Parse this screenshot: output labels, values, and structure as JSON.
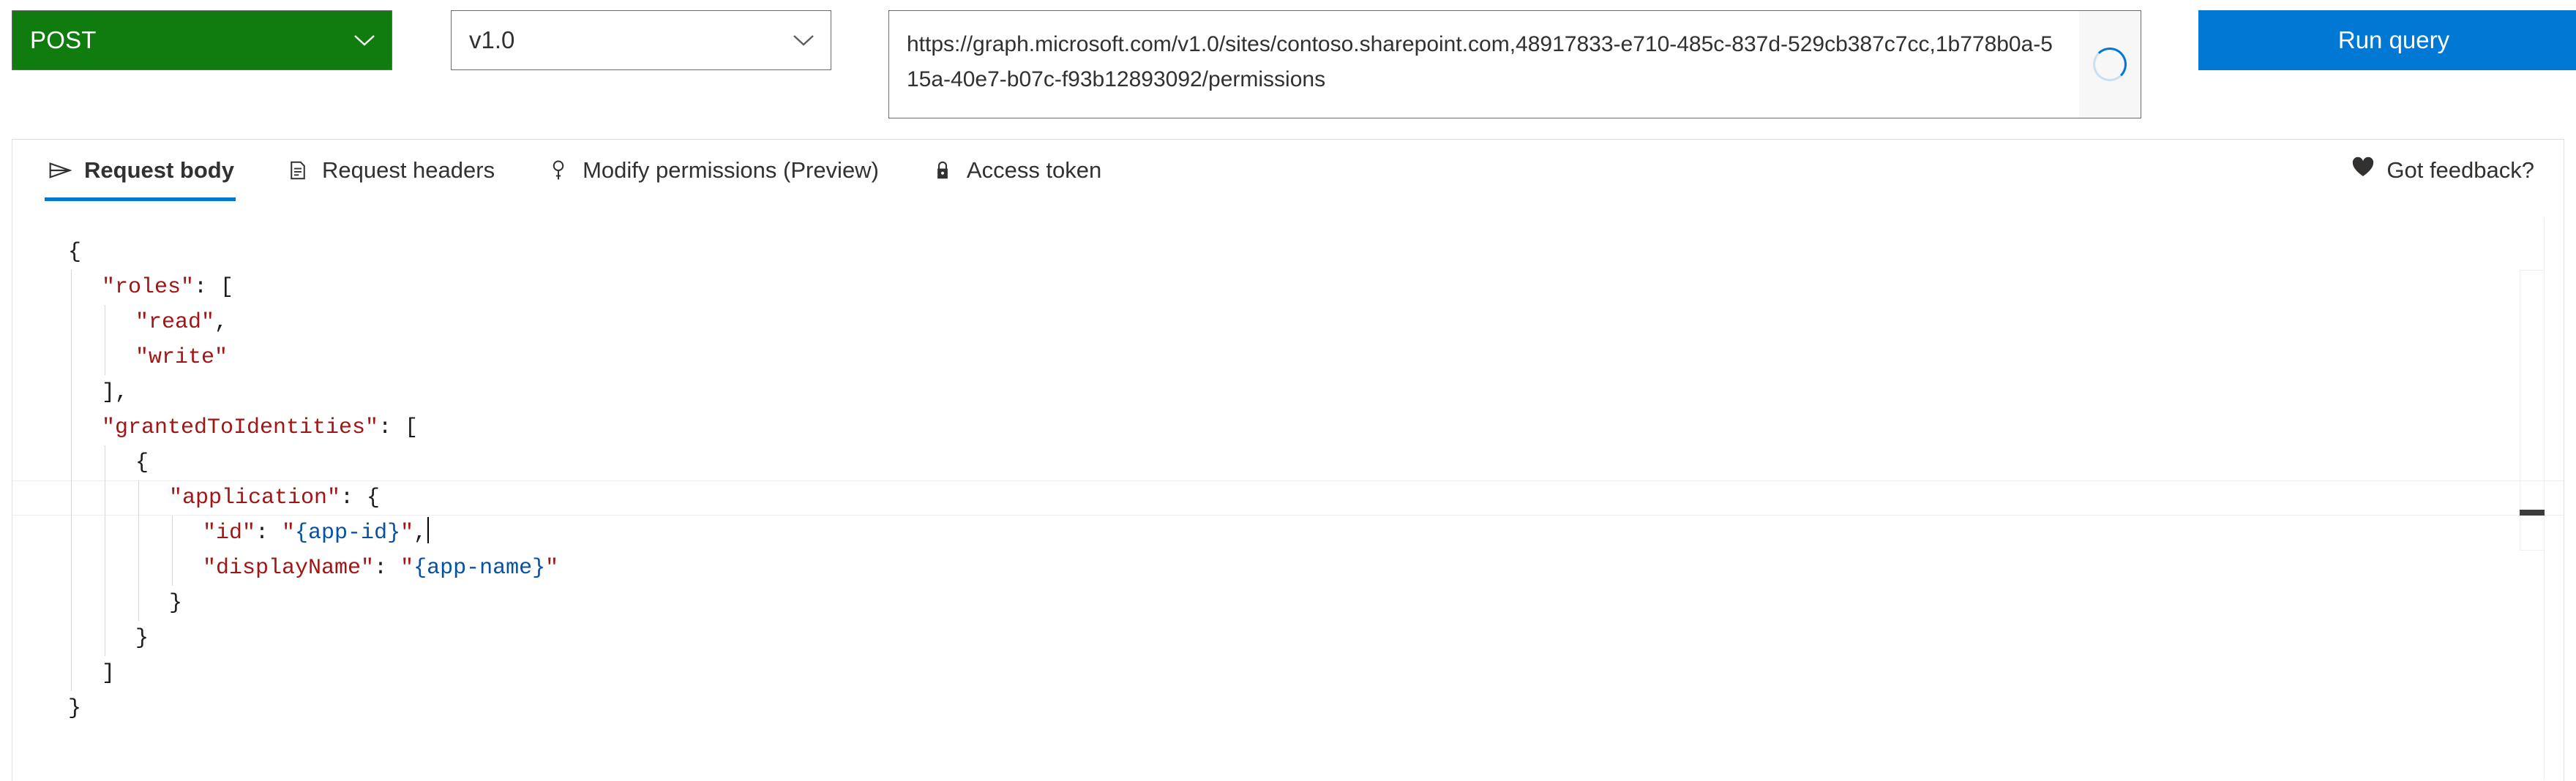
{
  "query_bar": {
    "method": "POST",
    "version": "v1.0",
    "url": "https://graph.microsoft.com/v1.0/sites/contoso.sharepoint.com,48917833-e710-485c-837d-529cb387c7cc,1b778b0a-515a-40e7-b07c-f93b12893092/permissions",
    "run_label": "Run query",
    "spinner_name": "loading-spinner",
    "chevron_name": "chevron-down-icon",
    "colors": {
      "method_green": "#107c10",
      "run_blue": "#0078d4",
      "accent": "#0078d4"
    }
  },
  "tabs": [
    {
      "label": "Request body",
      "icon": "send-icon",
      "active": true
    },
    {
      "label": "Request headers",
      "icon": "document-icon",
      "active": false
    },
    {
      "label": "Modify permissions (Preview)",
      "icon": "key-icon",
      "active": false
    },
    {
      "label": "Access token",
      "icon": "lock-icon",
      "active": false
    }
  ],
  "feedback": {
    "label": "Got feedback?",
    "icon": "heart-icon"
  },
  "editor": {
    "language": "json",
    "current_line": 7,
    "lines": [
      {
        "indent": 0,
        "parts": [
          {
            "t": "{",
            "c": "punct"
          }
        ]
      },
      {
        "indent": 1,
        "parts": [
          {
            "t": "\"roles\"",
            "c": "str"
          },
          {
            "t": ": [",
            "c": "punct"
          }
        ]
      },
      {
        "indent": 2,
        "parts": [
          {
            "t": "\"read\"",
            "c": "str"
          },
          {
            "t": ",",
            "c": "punct"
          }
        ]
      },
      {
        "indent": 2,
        "parts": [
          {
            "t": "\"write\"",
            "c": "str"
          }
        ]
      },
      {
        "indent": 1,
        "parts": [
          {
            "t": "],",
            "c": "punct"
          }
        ]
      },
      {
        "indent": 1,
        "parts": [
          {
            "t": "\"grantedToIdentities\"",
            "c": "str"
          },
          {
            "t": ": [",
            "c": "punct"
          }
        ]
      },
      {
        "indent": 2,
        "parts": [
          {
            "t": "{",
            "c": "punct"
          }
        ]
      },
      {
        "indent": 3,
        "parts": [
          {
            "t": "\"application\"",
            "c": "str"
          },
          {
            "t": ": {",
            "c": "punct"
          }
        ]
      },
      {
        "indent": 4,
        "caret": true,
        "parts": [
          {
            "t": "\"id\"",
            "c": "str"
          },
          {
            "t": ": ",
            "c": "punct"
          },
          {
            "t": "\"",
            "c": "str"
          },
          {
            "t": "{app-id}",
            "c": "ph"
          },
          {
            "t": "\"",
            "c": "str"
          },
          {
            "t": ",",
            "c": "punct"
          }
        ]
      },
      {
        "indent": 4,
        "parts": [
          {
            "t": "\"displayName\"",
            "c": "str"
          },
          {
            "t": ": ",
            "c": "punct"
          },
          {
            "t": "\"",
            "c": "str"
          },
          {
            "t": "{app-name}",
            "c": "ph"
          },
          {
            "t": "\"",
            "c": "str"
          }
        ]
      },
      {
        "indent": 3,
        "parts": [
          {
            "t": "}",
            "c": "punct"
          }
        ]
      },
      {
        "indent": 2,
        "parts": [
          {
            "t": "}",
            "c": "punct"
          }
        ]
      },
      {
        "indent": 1,
        "parts": [
          {
            "t": "]",
            "c": "punct"
          }
        ]
      },
      {
        "indent": 0,
        "parts": [
          {
            "t": "}",
            "c": "punct"
          }
        ]
      }
    ]
  }
}
